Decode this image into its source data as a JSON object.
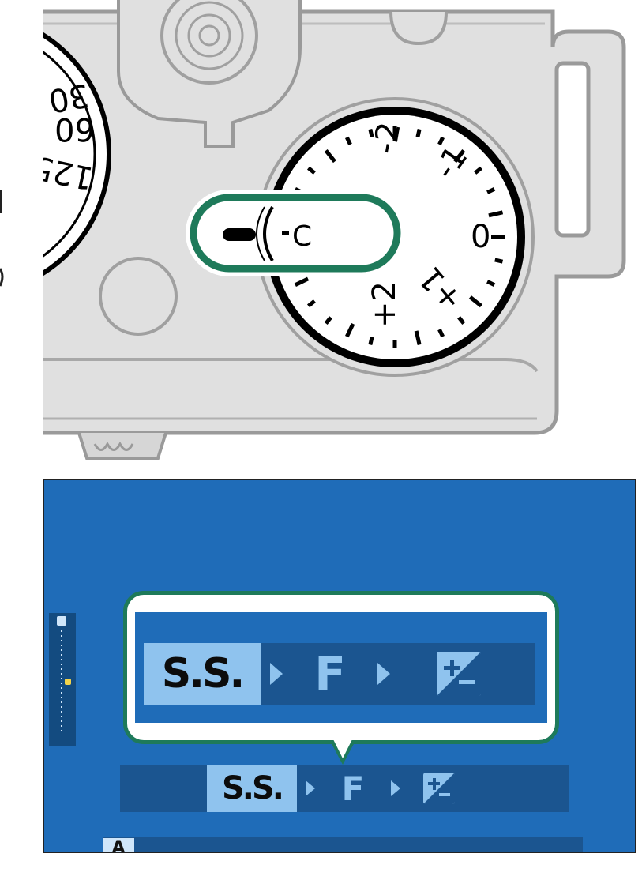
{
  "colors": {
    "lcd_bg": "#1f6cb8",
    "bar_dark": "#1b5590",
    "selected_bg": "#8fc3ee",
    "highlight_outline": "#1e7a5a",
    "camera_body": "#e0e0e0"
  },
  "dial": {
    "marks": [
      "-2",
      "-1",
      "0",
      "+1",
      "+2",
      "C"
    ],
    "selected_position": "C"
  },
  "left_dial": {
    "visible_numbers": [
      "30",
      "60",
      "125"
    ]
  },
  "exposure_scale": {
    "icon": "exposure-compensation-icon",
    "indicator_level": 0.5
  },
  "mode_cycle_zoomed": {
    "items": [
      "S.S.",
      "F",
      "exposure-compensation-icon"
    ],
    "selected_index": 0
  },
  "mode_cycle": {
    "items": [
      "S.S.",
      "F",
      "exposure-compensation-icon"
    ],
    "selected_index": 0
  },
  "status_bar": {
    "mode": "A"
  }
}
